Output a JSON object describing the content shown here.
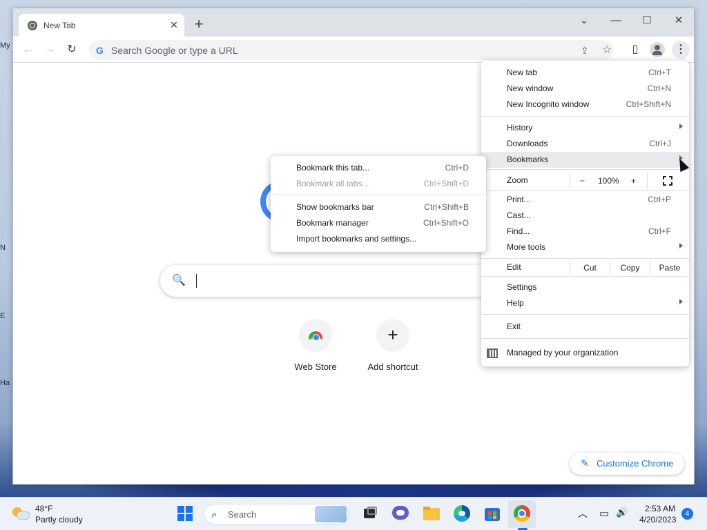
{
  "desktop": {
    "labels": [
      "My",
      "N",
      "E",
      "Ha"
    ]
  },
  "browser": {
    "tab": {
      "title": "New Tab",
      "close_glyph": "✕"
    },
    "newtab_glyph": "+",
    "window_controls": {
      "chevron": "⌄",
      "minimize": "—",
      "maximize": "☐",
      "close": "✕"
    },
    "toolbar": {
      "back_glyph": "←",
      "forward_glyph": "→",
      "reload_glyph": "↻",
      "omnibox_g": "G",
      "omnibox_placeholder": "Search Google or type a URL",
      "share_glyph": "⇪",
      "star_glyph": "☆",
      "sidepanel_glyph": "▯",
      "menu_glyph": "⋮"
    }
  },
  "ntp": {
    "search_glyph": "🔍",
    "shortcuts": [
      {
        "label": "Web Store",
        "icon": "web-store-icon"
      },
      {
        "label": "Add shortcut",
        "icon": "plus-icon",
        "glyph": "+"
      }
    ],
    "customize": {
      "label": "Customize Chrome",
      "glyph": "✎"
    }
  },
  "menu": {
    "group1": [
      {
        "label": "New tab",
        "shortcut": "Ctrl+T"
      },
      {
        "label": "New window",
        "shortcut": "Ctrl+N"
      },
      {
        "label": "New Incognito window",
        "shortcut": "Ctrl+Shift+N"
      }
    ],
    "group2": [
      {
        "label": "History",
        "shortcut": ""
      },
      {
        "label": "Downloads",
        "shortcut": "Ctrl+J"
      },
      {
        "label": "Bookmarks",
        "shortcut": ""
      }
    ],
    "zoom": {
      "label": "Zoom",
      "minus": "−",
      "value": "100%",
      "plus": "+"
    },
    "group3": [
      {
        "label": "Print...",
        "shortcut": "Ctrl+P"
      },
      {
        "label": "Cast...",
        "shortcut": ""
      },
      {
        "label": "Find...",
        "shortcut": "Ctrl+F"
      },
      {
        "label": "More tools",
        "shortcut": ""
      }
    ],
    "edit": {
      "label": "Edit",
      "cut": "Cut",
      "copy": "Copy",
      "paste": "Paste"
    },
    "group4": [
      {
        "label": "Settings"
      },
      {
        "label": "Help"
      }
    ],
    "exit": "Exit",
    "managed": "Managed by your organization"
  },
  "bookmarks_submenu": {
    "items": [
      {
        "label": "Bookmark this tab...",
        "shortcut": "Ctrl+D",
        "enabled": true
      },
      {
        "label": "Bookmark all tabs...",
        "shortcut": "Ctrl+Shift+D",
        "enabled": false
      },
      {
        "label": "Show bookmarks bar",
        "shortcut": "Ctrl+Shift+B",
        "enabled": true
      },
      {
        "label": "Bookmark manager",
        "shortcut": "Ctrl+Shift+O",
        "enabled": true
      },
      {
        "label": "Import bookmarks and settings...",
        "shortcut": "",
        "enabled": true
      }
    ]
  },
  "taskbar": {
    "weather": {
      "temp": "48°F",
      "desc": "Partly cloudy"
    },
    "search_label": "Search",
    "search_glyph": "⌕",
    "tray": {
      "chevron": "︿",
      "network_glyph": "▭",
      "volume_glyph": "🔊",
      "time": "2:53 AM",
      "date": "4/20/2023",
      "notifications": "4"
    },
    "colors": {
      "accent": "#1a73e8",
      "chrome_red": "#ea4335",
      "chrome_yellow": "#fbbc04",
      "chrome_green": "#34a853"
    }
  }
}
